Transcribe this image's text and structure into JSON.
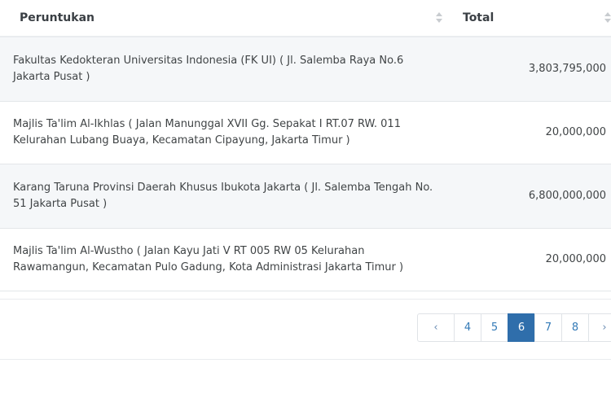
{
  "table": {
    "columns": [
      {
        "label": "Peruntukan"
      },
      {
        "label": "Total"
      }
    ],
    "rows": [
      {
        "peruntukan": "Fakultas Kedokteran Universitas Indonesia (FK UI) ( Jl. Salemba Raya No.6 Jakarta Pusat )",
        "total": "3,803,795,000"
      },
      {
        "peruntukan": "Majlis Ta'lim Al-Ikhlas ( Jalan Manunggal XVII Gg. Sepakat I RT.07 RW. 011 Kelurahan Lubang Buaya, Kecamatan Cipayung, Jakarta Timur )",
        "total": "20,000,000"
      },
      {
        "peruntukan": "Karang Taruna Provinsi Daerah Khusus Ibukota Jakarta ( Jl. Salemba Tengah No. 51 Jakarta Pusat )",
        "total": "6,800,000,000"
      },
      {
        "peruntukan": "Majlis Ta'lim Al-Wustho ( Jalan Kayu Jati V RT 005 RW 05 Kelurahan Rawamangun, Kecamatan Pulo Gadung, Kota Administrasi Jakarta Timur )",
        "total": "20,000,000"
      }
    ]
  },
  "pagination": {
    "prev": "‹",
    "pages": [
      "4",
      "5",
      "6",
      "7",
      "8"
    ],
    "active": "6",
    "next": "›"
  },
  "icons": {
    "sort": "sort-icon",
    "prev": "chevron-left-icon",
    "next": "chevron-right-icon"
  },
  "colors": {
    "active_page": "#2f6eab",
    "link": "#337ab7",
    "stripe": "#f5f7f9"
  }
}
